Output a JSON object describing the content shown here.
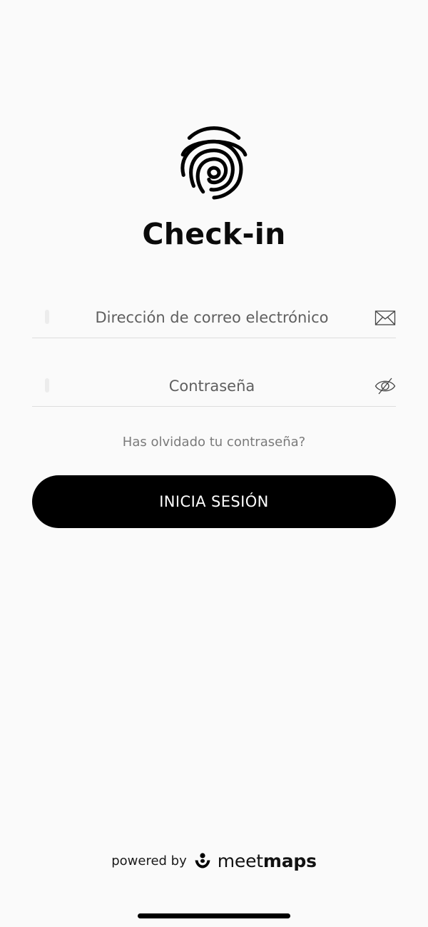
{
  "header": {
    "title": "Check-in",
    "logo_icon": "fingerprint-icon"
  },
  "form": {
    "email": {
      "placeholder": "Dirección de correo electrónico",
      "value": "",
      "icon": "envelope-icon"
    },
    "password": {
      "placeholder": "Contraseña",
      "value": "",
      "icon": "eye-slash-icon"
    },
    "forgot_password_label": "Has olvidado tu contraseña?",
    "login_button_label": "INICIA SESIÓN"
  },
  "footer": {
    "powered_by": "powered by",
    "brand_light": "meet",
    "brand_bold": "maps",
    "brand_icon": "meetmaps-logo-icon"
  },
  "colors": {
    "background": "#fafafa",
    "button": "#000000",
    "button_text": "#ffffff",
    "divider": "#dddddd",
    "placeholder": "#5f5f5f",
    "link": "#7a7a7a"
  }
}
